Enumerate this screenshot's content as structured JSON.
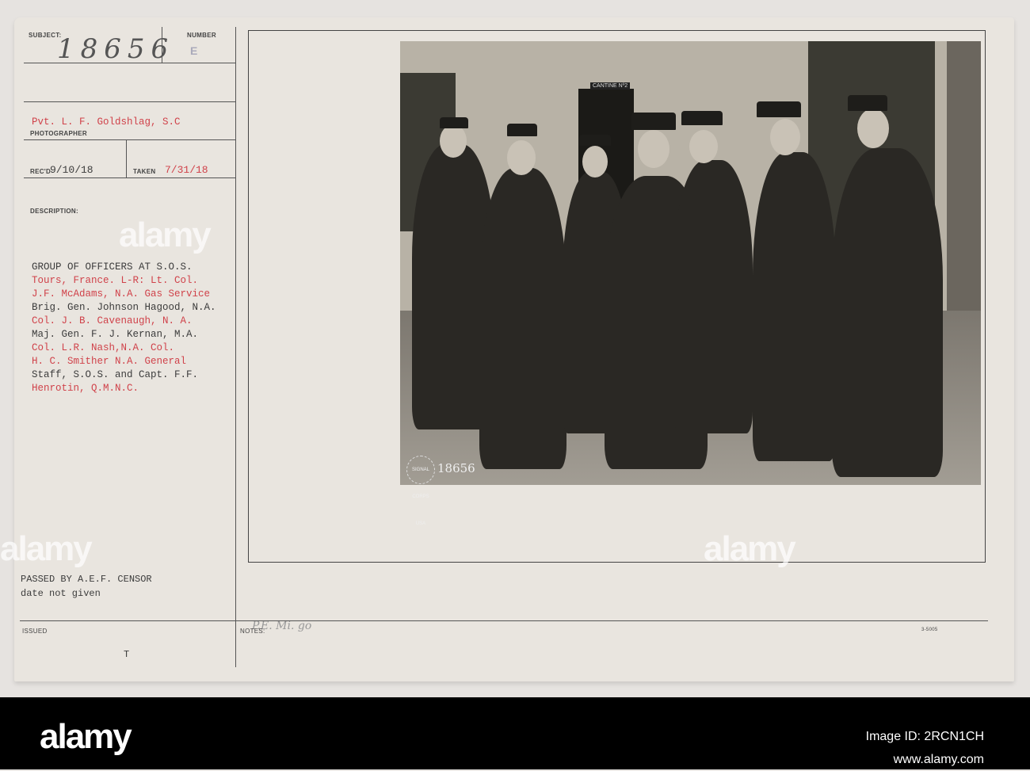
{
  "card": {
    "subject_label": "SUBJECT:",
    "subject_value": "18656",
    "number_label": "NUMBER",
    "number_value": "E",
    "photographer_value": "Pvt. L. F. Goldshlag, S.C",
    "photographer_label": "PHOTOGRAPHER",
    "recd_label": "REC'D",
    "recd_value": "9/10/18",
    "taken_label": "TAKEN",
    "taken_value": "7/31/18",
    "description_label": "DESCRIPTION:",
    "description_lines": [
      "GROUP OF OFFICERS AT S.O.S.",
      "Tours, France. L-R: Lt. Col.",
      "J.F. McAdams, N.A. Gas Service",
      "Brig. Gen. Johnson Hagood, N.A.",
      "Col. J. B. Cavenaugh, N. A.",
      "Maj. Gen. F. J. Kernan, M.A.",
      "Col. L.R. Nash,N.A. Col.",
      "H. C. Smither N.A. General",
      "Staff, S.O.S. and Capt. F.F.",
      "Henrotin, Q.M.N.C."
    ],
    "censor_line1": "PASSED BY A.E.F. CENSOR",
    "censor_line2": "date not given",
    "issued_label": "ISSUED",
    "issued_value": "T",
    "notes_label": "NOTES:",
    "notes_handwritten": "P.E. Mi. go",
    "form_number": "3-5005"
  },
  "photo": {
    "sign_text": "CANTINE Nº2",
    "stamp_text": "SIGNAL CORPS USA",
    "stamp_number": "18656"
  },
  "footer": {
    "logo": "alamy",
    "image_id": "Image ID: 2RCN1CH",
    "url": "www.alamy.com"
  },
  "colors": {
    "typed_red": "#d0424a",
    "typed_black": "#3c3c3c"
  }
}
